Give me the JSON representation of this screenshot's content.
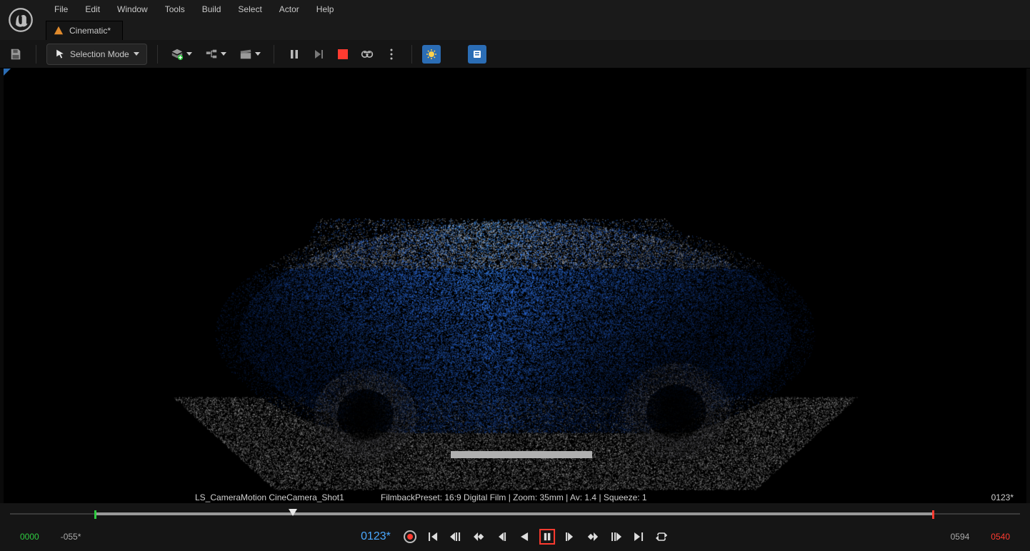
{
  "menus": [
    "File",
    "Edit",
    "Window",
    "Tools",
    "Build",
    "Select",
    "Actor",
    "Help"
  ],
  "tab": {
    "label": "Cinematic*"
  },
  "toolbar": {
    "mode_label": "Selection Mode"
  },
  "viewport": {
    "camera_label": "LS_CameraMotion  CineCamera_Shot1",
    "filmback_label": "FilmbackPreset: 16:9 Digital Film | Zoom: 35mm | Av: 1.4 | Squeeze: 1",
    "frame_overlay": "0123*"
  },
  "timeline": {
    "in_frame": "0000",
    "offset": "-055*",
    "current": "0123*",
    "end_a": "0594",
    "end_b": "0540"
  }
}
